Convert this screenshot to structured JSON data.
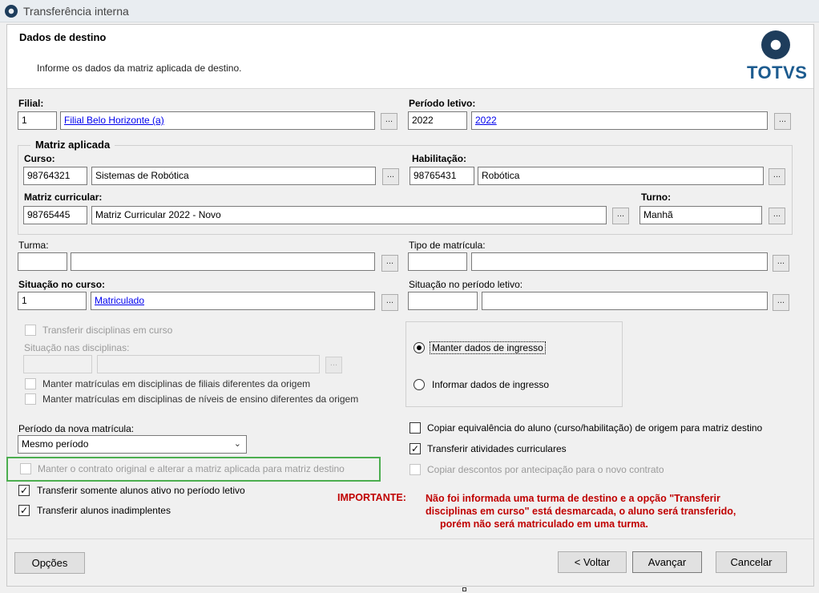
{
  "window": {
    "title": "Transferência interna"
  },
  "header": {
    "title": "Dados de destino",
    "subtitle": "Informe os dados da matriz aplicada de destino.",
    "logo_text": "TOTVS"
  },
  "filial": {
    "label": "Filial:",
    "code": "1",
    "name": "Filial Belo Horizonte (a)"
  },
  "periodo_letivo": {
    "label": "Período letivo:",
    "code": "2022",
    "name": "2022"
  },
  "matriz_aplicada": {
    "legend": "Matriz aplicada",
    "curso": {
      "label": "Curso:",
      "code": "98764321",
      "name": "Sistemas de Robótica"
    },
    "habilitacao": {
      "label": "Habilitação:",
      "code": "98765431",
      "name": "Robótica"
    },
    "matriz_curricular": {
      "label": "Matriz curricular:",
      "code": "98765445",
      "name": "Matriz Curricular 2022 - Novo"
    },
    "turno": {
      "label": "Turno:",
      "value": "Manhã"
    }
  },
  "turma": {
    "label": "Turma:",
    "code": "",
    "name": ""
  },
  "tipo_matricula": {
    "label": "Tipo de matrícula:",
    "code": "",
    "name": ""
  },
  "situacao_curso": {
    "label": "Situação no curso:",
    "code": "1",
    "name": "Matriculado"
  },
  "situacao_periodo": {
    "label": "Situação no período letivo:",
    "code": "",
    "name": ""
  },
  "disciplinas": {
    "transferir_label": "Transferir disciplinas em curso",
    "situacao_label": "Situação nas disciplinas:",
    "manter_filiais_label": "Manter matrículas em disciplinas de filiais diferentes da origem",
    "manter_niveis_label": "Manter matrículas em disciplinas de níveis de ensino diferentes da origem"
  },
  "ingresso": {
    "manter_label": "Manter dados de ingresso",
    "informar_label": "Informar dados de ingresso",
    "selected": "manter"
  },
  "periodo_nova": {
    "label": "Período da nova matrícula:",
    "value": "Mesmo período"
  },
  "checks": {
    "manter_contrato": {
      "label": "Manter o contrato original e alterar a matriz aplicada para matriz destino",
      "checked": false
    },
    "somente_ativos": {
      "label": "Transferir somente alunos ativo no período letivo",
      "checked": true
    },
    "inadimplentes": {
      "label": "Transferir alunos inadimplentes",
      "checked": true
    },
    "copiar_equivalencia": {
      "label": "Copiar equivalência do aluno (curso/habilitação) de origem para matriz destino",
      "checked": false
    },
    "transferir_atividades": {
      "label": "Transferir atividades curriculares",
      "checked": true
    },
    "copiar_descontos": {
      "label": "Copiar descontos por antecipação para o novo contrato",
      "checked": false
    }
  },
  "importante": {
    "label": "IMPORTANTE:",
    "line1": "Não foi informada uma turma de destino e a opção \"Transferir",
    "line2": "disciplinas em curso\" está desmarcada, o aluno será transferido,",
    "line3": "porém não será matriculado em uma turma."
  },
  "footer": {
    "opcoes": "Opções",
    "voltar": "< Voltar",
    "avancar": "Avançar",
    "cancelar": "Cancelar"
  },
  "lookup_glyph": "..."
}
